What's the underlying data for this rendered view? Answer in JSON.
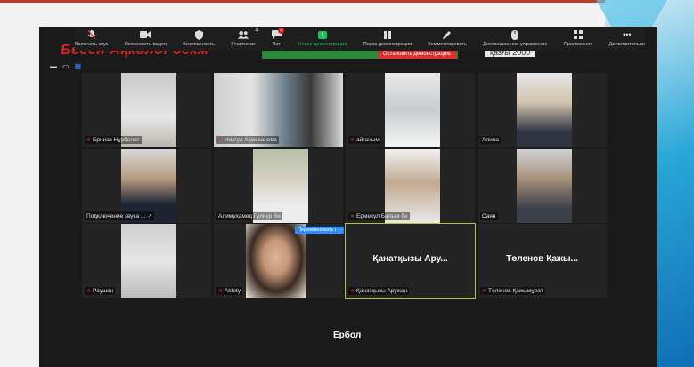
{
  "toolbar": {
    "items": [
      {
        "label": "Включить звук",
        "icon": "mic-off-icon"
      },
      {
        "label": "Остановить видео",
        "icon": "video-icon"
      },
      {
        "label": "Безопасность",
        "icon": "shield-icon"
      },
      {
        "label": "Участники",
        "icon": "participants-icon",
        "count": "11"
      },
      {
        "label": "Чат",
        "icon": "chat-icon",
        "badge": "2"
      },
      {
        "label": "Новая демонстрация",
        "icon": "share-icon"
      },
      {
        "label": "Пауза демонстрации",
        "icon": "pause-icon"
      },
      {
        "label": "Комментировать",
        "icon": "pencil-icon"
      },
      {
        "label": "Дистанционное управление",
        "icon": "remote-control-icon"
      },
      {
        "label": "Приложения",
        "icon": "apps-icon"
      },
      {
        "label": "Дополнительно",
        "icon": "more-icon"
      }
    ]
  },
  "share_banner": {
    "title": "Бесен Ақкөлді бекж",
    "stop_label": "Остановить демонстрацию",
    "right_text": "қазғы 2000"
  },
  "tiles": [
    {
      "name": "Ерниаз Нұрболат",
      "mic": "muted"
    },
    {
      "name": "Назгул Ақмаханова",
      "mic": "muted"
    },
    {
      "name": "айганым",
      "mic": "muted"
    },
    {
      "name": "Алина",
      "mic": "none"
    },
    {
      "name": "Подключение звука ...",
      "mic": "connecting"
    },
    {
      "name": "Алимухамед Гулнур Ве",
      "mic": "none"
    },
    {
      "name": "Ермекул Балым бе",
      "mic": "muted"
    },
    {
      "name": "Саян",
      "mic": "none"
    },
    {
      "name": "Раушан",
      "mic": "muted"
    },
    {
      "name": "Aktoty",
      "mic": "muted"
    },
    {
      "name": "Қанатқызы Аружан",
      "mic": "muted",
      "big": "Қанатқызы Ару..."
    },
    {
      "name": "Төленов Қажымұрат",
      "mic": "muted",
      "big": "Төленов Қажы..."
    }
  ],
  "rename_label": "Переименовать вы",
  "more_label": "...",
  "bottom_participant": "Ербол",
  "colors": {
    "accent": "#2d8cff",
    "share_green": "#1fc35b",
    "muted_red": "#e33333",
    "active_border": "#b5c43a"
  }
}
